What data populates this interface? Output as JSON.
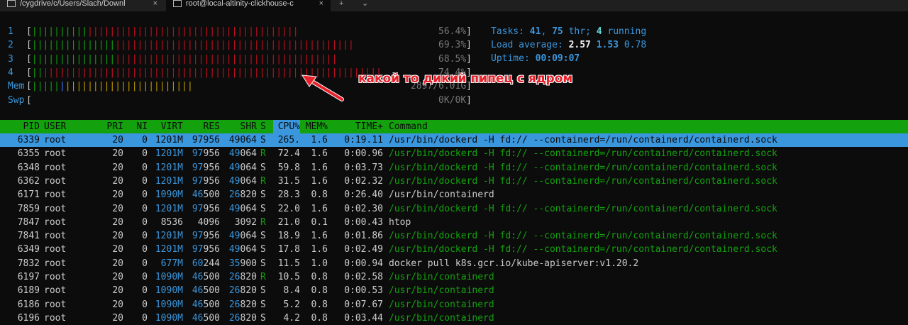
{
  "tabs": [
    {
      "label": "/cygdrive/c/Users/Slach/Downl",
      "active": false
    },
    {
      "label": "root@local-altinity-clickhouse-c",
      "active": true
    }
  ],
  "tab_close": "×",
  "new_tab": "+",
  "dropdown": "⌄",
  "meters": [
    {
      "label": "1",
      "value": "56.4%",
      "bars": {
        "g": 10,
        "r": 38,
        "b": 0,
        "y": 0
      }
    },
    {
      "label": "2",
      "value": "69.3%",
      "bars": {
        "g": 15,
        "r": 43,
        "b": 0,
        "y": 0
      }
    },
    {
      "label": "3",
      "value": "68.5%",
      "bars": {
        "g": 15,
        "r": 40,
        "b": 0,
        "y": 0
      }
    },
    {
      "label": "4",
      "value": "74.4%",
      "bars": {
        "g": 2,
        "r": 61,
        "b": 0,
        "y": 0
      }
    },
    {
      "label": "Mem",
      "value": "2897/6.01G",
      "bars": {
        "g": 5,
        "r": 0,
        "b": 1,
        "y": 23
      }
    },
    {
      "label": "Swp",
      "value": "0K/0K",
      "bars": {
        "g": 0,
        "r": 0,
        "b": 0,
        "y": 0
      }
    }
  ],
  "stats": {
    "tasks_label": "Tasks: ",
    "tasks": "41",
    "thr": "75",
    "thr_label": " thr; ",
    "running": "4",
    "running_label": " running",
    "load_label": "Load average: ",
    "load1": "2.57",
    "load5": "1.53",
    "load15": "0.78",
    "uptime_label": "Uptime: ",
    "uptime": "00:09:07"
  },
  "annotation": "какой то дикий пипец с ядром",
  "columns": {
    "pid": "PID",
    "user": "USER",
    "pri": "PRI",
    "ni": "NI",
    "virt": "VIRT",
    "res": "RES",
    "shr": "SHR",
    "s": "S",
    "cpu": "CPU%",
    "mem": "MEM%",
    "time": "TIME+",
    "cmd": "Command"
  },
  "processes": [
    {
      "pid": "6339",
      "user": "root",
      "pri": "20",
      "ni": "0",
      "virt": "1201M",
      "res": "97956",
      "shr": "49064",
      "s": "S",
      "cpu": "265.",
      "mem": "1.6",
      "time": "0:19.11",
      "cmd": "/usr/bin/dockerd -H fd:// --containerd=/run/containerd/containerd.sock",
      "thread": false,
      "selected": true
    },
    {
      "pid": "6355",
      "user": "root",
      "pri": "20",
      "ni": "0",
      "virt": "1201M",
      "res": "97956",
      "shr": "49064",
      "s": "R",
      "cpu": "72.4",
      "mem": "1.6",
      "time": "0:00.96",
      "cmd": "/usr/bin/dockerd -H fd:// --containerd=/run/containerd/containerd.sock",
      "thread": true
    },
    {
      "pid": "6348",
      "user": "root",
      "pri": "20",
      "ni": "0",
      "virt": "1201M",
      "res": "97956",
      "shr": "49064",
      "s": "S",
      "cpu": "59.8",
      "mem": "1.6",
      "time": "0:03.73",
      "cmd": "/usr/bin/dockerd -H fd:// --containerd=/run/containerd/containerd.sock",
      "thread": true
    },
    {
      "pid": "6362",
      "user": "root",
      "pri": "20",
      "ni": "0",
      "virt": "1201M",
      "res": "97956",
      "shr": "49064",
      "s": "R",
      "cpu": "31.5",
      "mem": "1.6",
      "time": "0:02.32",
      "cmd": "/usr/bin/dockerd -H fd:// --containerd=/run/containerd/containerd.sock",
      "thread": true
    },
    {
      "pid": "6171",
      "user": "root",
      "pri": "20",
      "ni": "0",
      "virt": "1090M",
      "res": "46500",
      "shr": "26820",
      "s": "S",
      "cpu": "28.3",
      "mem": "0.8",
      "time": "0:26.40",
      "cmd": "/usr/bin/containerd",
      "thread": false
    },
    {
      "pid": "7859",
      "user": "root",
      "pri": "20",
      "ni": "0",
      "virt": "1201M",
      "res": "97956",
      "shr": "49064",
      "s": "S",
      "cpu": "22.0",
      "mem": "1.6",
      "time": "0:02.30",
      "cmd": "/usr/bin/dockerd -H fd:// --containerd=/run/containerd/containerd.sock",
      "thread": true
    },
    {
      "pid": "7847",
      "user": "root",
      "pri": "20",
      "ni": "0",
      "virt": "8536",
      "res": "4096",
      "shr": "3092",
      "s": "R",
      "cpu": "21.0",
      "mem": "0.1",
      "time": "0:00.43",
      "cmd": "htop",
      "thread": false
    },
    {
      "pid": "7841",
      "user": "root",
      "pri": "20",
      "ni": "0",
      "virt": "1201M",
      "res": "97956",
      "shr": "49064",
      "s": "S",
      "cpu": "18.9",
      "mem": "1.6",
      "time": "0:01.86",
      "cmd": "/usr/bin/dockerd -H fd:// --containerd=/run/containerd/containerd.sock",
      "thread": true
    },
    {
      "pid": "6349",
      "user": "root",
      "pri": "20",
      "ni": "0",
      "virt": "1201M",
      "res": "97956",
      "shr": "49064",
      "s": "S",
      "cpu": "17.8",
      "mem": "1.6",
      "time": "0:02.49",
      "cmd": "/usr/bin/dockerd -H fd:// --containerd=/run/containerd/containerd.sock",
      "thread": true
    },
    {
      "pid": "7832",
      "user": "root",
      "pri": "20",
      "ni": "0",
      "virt": "677M",
      "res": "60244",
      "shr": "35900",
      "s": "S",
      "cpu": "11.5",
      "mem": "1.0",
      "time": "0:00.94",
      "cmd": "docker pull k8s.gcr.io/kube-apiserver:v1.20.2",
      "thread": false
    },
    {
      "pid": "6197",
      "user": "root",
      "pri": "20",
      "ni": "0",
      "virt": "1090M",
      "res": "46500",
      "shr": "26820",
      "s": "R",
      "cpu": "10.5",
      "mem": "0.8",
      "time": "0:02.58",
      "cmd": "/usr/bin/containerd",
      "thread": true
    },
    {
      "pid": "6189",
      "user": "root",
      "pri": "20",
      "ni": "0",
      "virt": "1090M",
      "res": "46500",
      "shr": "26820",
      "s": "S",
      "cpu": "8.4",
      "mem": "0.8",
      "time": "0:00.53",
      "cmd": "/usr/bin/containerd",
      "thread": true
    },
    {
      "pid": "6186",
      "user": "root",
      "pri": "20",
      "ni": "0",
      "virt": "1090M",
      "res": "46500",
      "shr": "26820",
      "s": "S",
      "cpu": "5.2",
      "mem": "0.8",
      "time": "0:07.67",
      "cmd": "/usr/bin/containerd",
      "thread": true
    },
    {
      "pid": "6196",
      "user": "root",
      "pri": "20",
      "ni": "0",
      "virt": "1090M",
      "res": "46500",
      "shr": "26820",
      "s": "S",
      "cpu": "4.2",
      "mem": "0.8",
      "time": "0:03.44",
      "cmd": "/usr/bin/containerd",
      "thread": true
    }
  ]
}
